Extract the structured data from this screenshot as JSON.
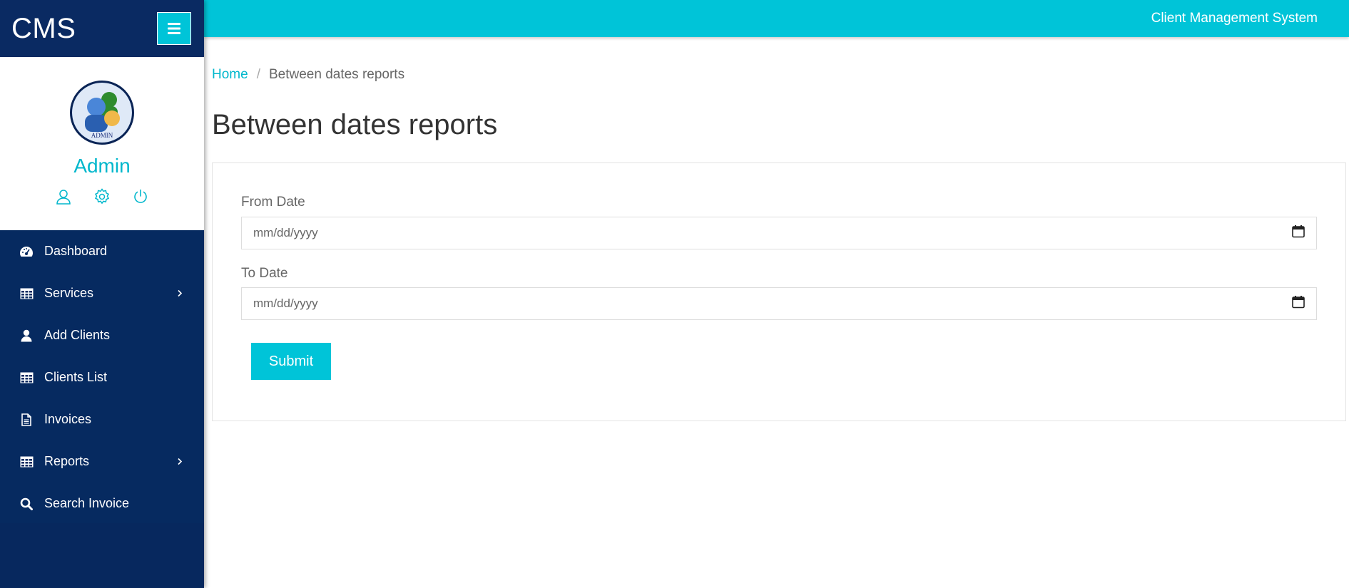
{
  "brand": {
    "name": "CMS"
  },
  "profile": {
    "name": "Admin",
    "avatar_text": "ADMIN"
  },
  "nav": {
    "items": [
      {
        "label": "Dashboard",
        "icon": "dashboard-icon"
      },
      {
        "label": "Services",
        "icon": "table-icon",
        "has_submenu": true
      },
      {
        "label": "Add Clients",
        "icon": "user-icon"
      },
      {
        "label": "Clients List",
        "icon": "table-icon"
      },
      {
        "label": "Invoices",
        "icon": "file-icon"
      },
      {
        "label": "Reports",
        "icon": "table-icon",
        "has_submenu": true
      },
      {
        "label": "Search Invoice",
        "icon": "search-icon"
      }
    ]
  },
  "topbar": {
    "title": "Client Management System"
  },
  "breadcrumb": {
    "home": "Home",
    "separator": "/",
    "current": "Between dates reports"
  },
  "page": {
    "title": "Between dates reports"
  },
  "form": {
    "from_label": "From Date",
    "from_placeholder": "mm/dd/yyyy",
    "to_label": "To Date",
    "to_placeholder": "mm/dd/yyyy",
    "submit_label": "Submit"
  },
  "colors": {
    "sidebar": "#062a60",
    "accent": "#00c4d8",
    "link": "#00b7cc"
  }
}
